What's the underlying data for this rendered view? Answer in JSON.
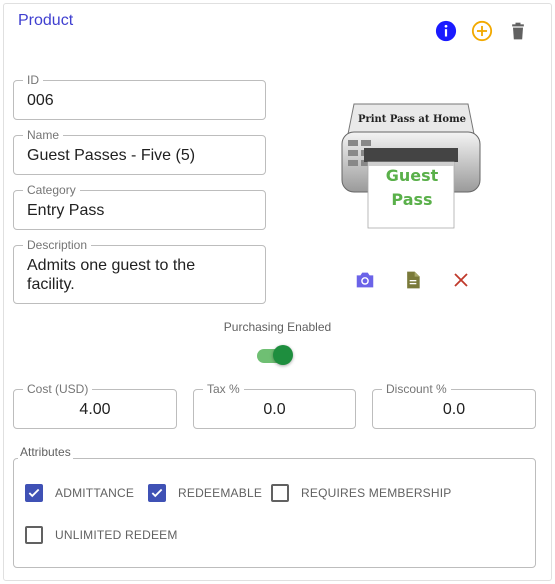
{
  "card": {
    "title": "Product",
    "actions": [
      {
        "icon": "info-icon",
        "color": "#1a1aff"
      },
      {
        "icon": "add-circle-icon",
        "color": "#f2a900"
      },
      {
        "icon": "trash-icon",
        "color": "#616161"
      }
    ]
  },
  "fields": {
    "id": {
      "label": "ID",
      "value": "006"
    },
    "name": {
      "label": "Name",
      "value": "Guest Passes - Five (5)"
    },
    "category": {
      "label": "Category",
      "value": "Entry Pass"
    },
    "description": {
      "label": "Description",
      "value_line1": "Admits one guest to the",
      "value_line2": "facility."
    },
    "cost": {
      "label": "Cost (USD)",
      "value": "4.00"
    },
    "tax": {
      "label": "Tax %",
      "value": "0.0"
    },
    "discount": {
      "label": "Discount %",
      "value": "0.0"
    }
  },
  "image": {
    "printer_text": "Print Pass at Home",
    "paper_line1": "Guest",
    "paper_line2": "Pass",
    "actions": [
      {
        "icon": "camera-icon",
        "color": "#6b63e8"
      },
      {
        "icon": "document-icon",
        "color": "#7a7a3a"
      },
      {
        "icon": "close-icon",
        "color": "#c0392b"
      }
    ]
  },
  "purchasing": {
    "label": "Purchasing Enabled",
    "enabled": true
  },
  "attributes": {
    "label": "Attributes",
    "items": [
      {
        "label": "ADMITTANCE",
        "checked": true
      },
      {
        "label": "REDEEMABLE",
        "checked": true
      },
      {
        "label": "REQUIRES MEMBERSHIP",
        "checked": false
      },
      {
        "label": "UNLIMITED REDEEM",
        "checked": false
      }
    ]
  }
}
